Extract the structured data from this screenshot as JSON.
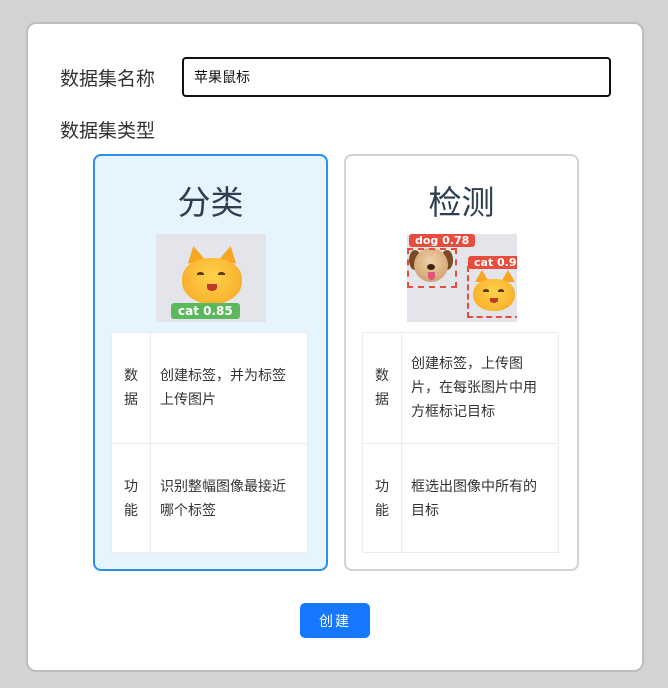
{
  "form": {
    "name_label": "数据集名称",
    "name_value": "苹果鼠标",
    "type_label": "数据集类型"
  },
  "types": [
    {
      "title": "分类",
      "selected": true,
      "badges": [
        "cat 0.85"
      ],
      "rows": [
        {
          "key": "数据",
          "value": "创建标签，并为标签上传图片"
        },
        {
          "key": "功能",
          "value": "识别整幅图像最接近哪个标签"
        }
      ]
    },
    {
      "title": "检测",
      "selected": false,
      "badges": [
        "dog 0.78",
        "cat 0.9"
      ],
      "rows": [
        {
          "key": "数据",
          "value": "创建标签，上传图片，在每张图片中用方框标记目标"
        },
        {
          "key": "功能",
          "value": "框选出图像中所有的目标"
        }
      ]
    }
  ],
  "actions": {
    "create_label": "创建"
  },
  "colors": {
    "accent": "#1677ff",
    "selected_border": "#2a8fe8",
    "selected_bg": "#e6f4fd",
    "badge_green": "#5cb85c",
    "badge_red": "#e74c3c"
  }
}
